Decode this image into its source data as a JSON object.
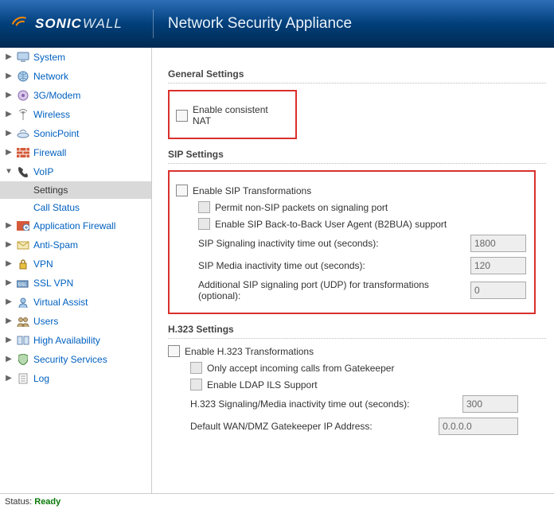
{
  "header": {
    "brand1": "SONIC",
    "brand2": "WALL",
    "title": "Network Security Appliance"
  },
  "nav": {
    "items": [
      {
        "label": "System"
      },
      {
        "label": "Network"
      },
      {
        "label": "3G/Modem"
      },
      {
        "label": "Wireless"
      },
      {
        "label": "SonicPoint"
      },
      {
        "label": "Firewall"
      },
      {
        "label": "VoIP"
      },
      {
        "label": "Application Firewall"
      },
      {
        "label": "Anti-Spam"
      },
      {
        "label": "VPN"
      },
      {
        "label": "SSL VPN"
      },
      {
        "label": "Virtual Assist"
      },
      {
        "label": "Users"
      },
      {
        "label": "High Availability"
      },
      {
        "label": "Security Services"
      },
      {
        "label": "Log"
      }
    ],
    "voip_sub": [
      {
        "label": "Settings"
      },
      {
        "label": "Call Status"
      }
    ]
  },
  "sections": {
    "general": {
      "title": "General Settings",
      "enable_nat": "Enable consistent NAT"
    },
    "sip": {
      "title": "SIP Settings",
      "enable": "Enable SIP Transformations",
      "permit": "Permit non-SIP packets on signaling port",
      "b2bua": "Enable SIP Back-to-Back User Agent (B2BUA) support",
      "sig_to": "SIP Signaling inactivity time out (seconds):",
      "sig_to_v": "1800",
      "med_to": "SIP Media inactivity time out (seconds):",
      "med_to_v": "120",
      "addl": "Additional SIP signaling port (UDP) for transformations (optional):",
      "addl_v": "0"
    },
    "h323": {
      "title": "H.323 Settings",
      "enable": "Enable H.323 Transformations",
      "gk": "Only accept incoming calls from Gatekeeper",
      "ldap": "Enable LDAP ILS Support",
      "to": "H.323 Signaling/Media inactivity time out (seconds):",
      "to_v": "300",
      "wan": "Default WAN/DMZ Gatekeeper IP Address:",
      "wan_v": "0.0.0.0"
    }
  },
  "status": {
    "label": "Status:",
    "value": "Ready"
  }
}
